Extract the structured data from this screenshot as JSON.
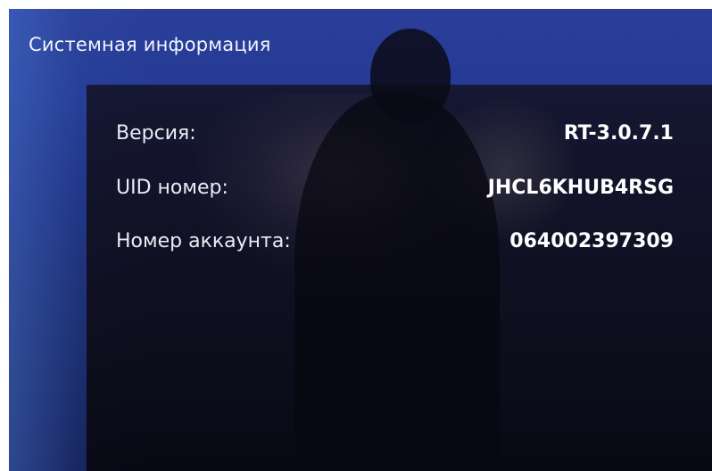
{
  "screen": {
    "title": "Системная информация"
  },
  "system_info": {
    "rows": [
      {
        "label": "Версия:",
        "value": "RT-3.0.7.1"
      },
      {
        "label": "UID номер:",
        "value": "JHCL6KHUB4RSG"
      },
      {
        "label": "Номер аккаунта:",
        "value": "064002397309"
      }
    ]
  },
  "colors": {
    "screen_blue": "#243a93",
    "panel_dark": "#141220",
    "text_white": "#ffffff"
  }
}
